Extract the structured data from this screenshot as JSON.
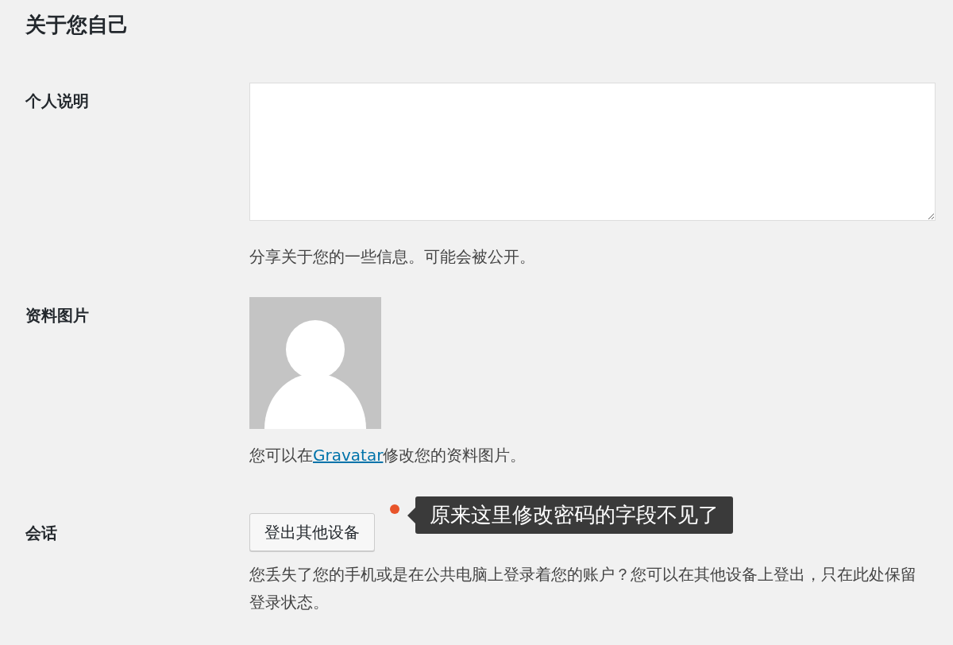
{
  "section_title": "关于您自己",
  "bio": {
    "label": "个人说明",
    "hint": "分享关于您的一些信息。可能会被公开。"
  },
  "avatar": {
    "label": "资料图片",
    "link": "Gravatar",
    "before": "您可以在",
    "after": "修改您的资料图片。"
  },
  "sessions": {
    "label": "会话",
    "button": "登出其他设备",
    "description": "您丢失了您的手机或是在公共电脑上登录着您的账户？您可以在其他设备上登出，只在此处保留登录状态。"
  },
  "annotation": {
    "text": "原来这里修改密码的字段不见了",
    "color": "#e8542a"
  }
}
